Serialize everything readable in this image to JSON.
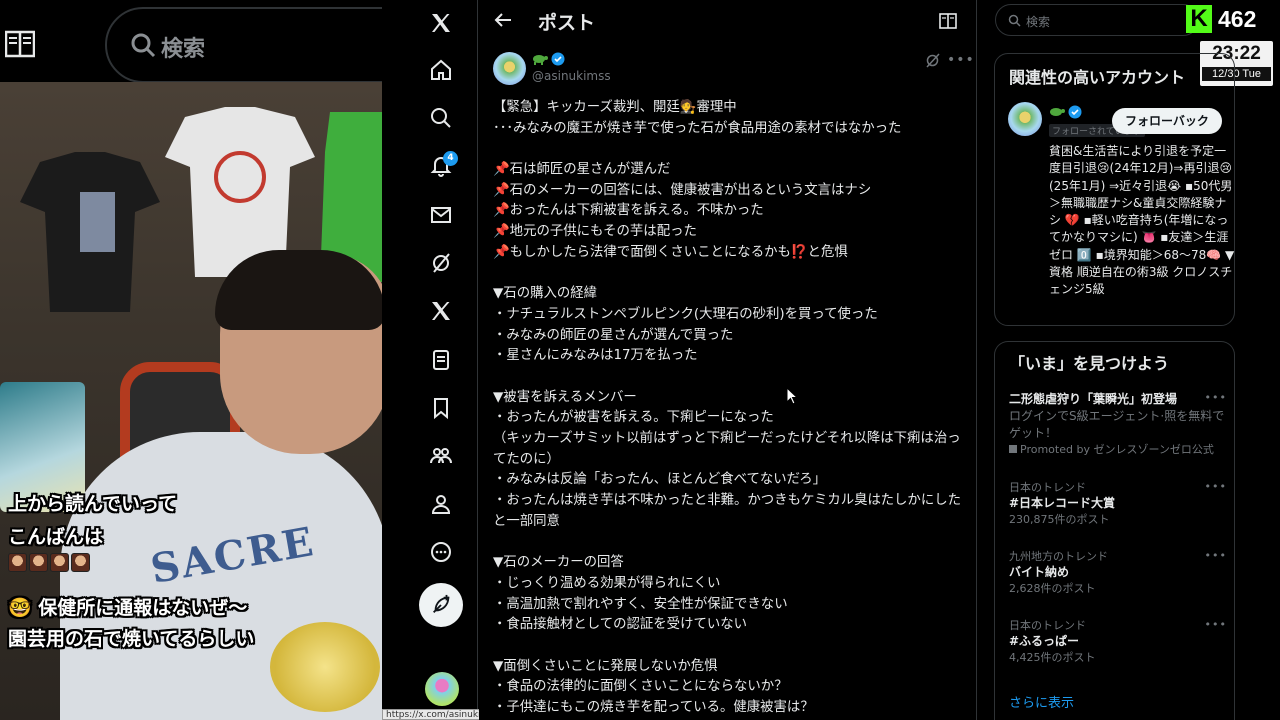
{
  "browser": {
    "search_placeholder": "検索",
    "status_url": "https://x.com/asinukimss"
  },
  "stream_overlay": {
    "lines": [
      "上から読んでいって",
      "こんばんは",
      "🤓 保健所に通報はないぜ～",
      "園芸用の石で焼いてるらしい"
    ],
    "shirt_print": "SACRE",
    "emote_count": 4
  },
  "nav": {
    "notification_count": "4",
    "items": [
      "x-logo",
      "home",
      "explore",
      "notifications",
      "messages",
      "grok",
      "x-premium",
      "lists",
      "bookmarks",
      "communities",
      "profile",
      "more"
    ]
  },
  "post": {
    "header_title": "ポスト",
    "author_handle": "@asinukimss",
    "lines": [
      "【緊急】キッカーズ裁判、開廷🧑‍⚖️審理中",
      "･･･みなみの魔王が焼き芋で使った石が食品用途の素材ではなかった",
      "",
      "📌石は師匠の星さんが選んだ",
      "📌石のメーカーの回答には、健康被害が出るという文言はナシ",
      "📌おったんは下痢被害を訴える。不味かった",
      "📌地元の子供にもその芋は配った",
      "📌もしかしたら法律で面倒くさいことになるかも⁉️と危惧",
      "",
      "▼石の購入の経緯",
      "・ナチュラルストンペブルピンク(大理石の砂利)を買って使った",
      "・みなみの師匠の星さんが選んで買った",
      "・星さんにみなみは17万を払った",
      "",
      "▼被害を訴えるメンバー",
      "・おったんが被害を訴える。下痢ピーになった",
      "（キッカーズサミット以前はずっと下痢ピーだったけどそれ以降は下痢は治ってたのに）",
      "・みなみは反論「おったん、ほとんど食べてないだろ」",
      "・おったんは焼き芋は不味かったと非難。かつきもケミカル臭はたしかにしたと一部同意",
      "",
      "▼石のメーカーの回答",
      "・じっくり温める効果が得られにくい",
      "・高温加熱で割れやすく、安全性が保証できない",
      "・食品接触材としての認証を受けていない",
      "",
      "▼面倒くさいことに発展しないか危惧",
      "・食品の法律的に面倒くさいことにならないか？",
      "・子供達にもこの焼き芋を配っている。健康被害は？"
    ]
  },
  "sidebar": {
    "search_placeholder": "検索",
    "kick_logo": "K",
    "viewer_count": "462",
    "clock_time": "23:22",
    "clock_date": "12/30 Tue",
    "related": {
      "title": "関連性の高いアカウント",
      "follows_you": "フォローされています",
      "follow_back": "フォローバック",
      "bio": "貧困&生活苦により引退を予定一度目引退😢(24年12月)⇒再引退😢(25年1月) ⇒近々引退😭 ▪50代男＞無職職歴ナシ&童貞交際経験ナシ 💔 ▪軽い吃音持ち(年増になってかなりマシに) 👅 ▪友達＞生涯ゼロ 0️⃣ ▪境界知能＞68～78🧠 ▼資格 順逆自在の術3級 クロノスチェンジ5級"
    },
    "trends": {
      "title": "「いま」を見つけよう",
      "items": [
        {
          "meta": "",
          "name": "二形態虐狩り「葉瞬光」初登場",
          "desc": "ログインでS級エージェント·照を無料でゲット！",
          "count": "Promoted by ゼンレスゾーンゼロ公式"
        },
        {
          "meta": "日本のトレンド",
          "name": "#日本レコード大賞",
          "desc": "",
          "count": "230,875件のポスト"
        },
        {
          "meta": "九州地方のトレンド",
          "name": "バイト納め",
          "desc": "",
          "count": "2,628件のポスト"
        },
        {
          "meta": "日本のトレンド",
          "name": "#ふるっぱー",
          "desc": "",
          "count": "4,425件のポスト"
        }
      ],
      "show_more": "さらに表示"
    }
  }
}
